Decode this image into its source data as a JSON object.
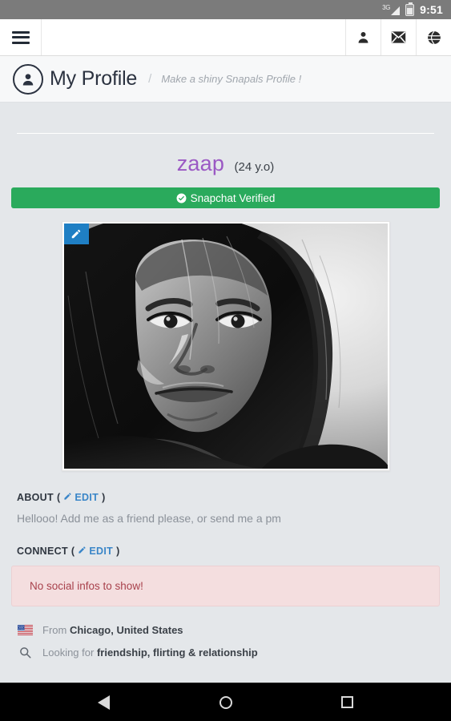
{
  "status_bar": {
    "network_label": "3G",
    "time": "9:51",
    "icons": [
      "signal-icon",
      "battery-icon"
    ]
  },
  "topbar": {
    "menu_icon": "hamburger-menu-icon",
    "actions": [
      {
        "icon": "person-icon",
        "name": "profile"
      },
      {
        "icon": "envelope-icon",
        "name": "messages"
      },
      {
        "icon": "globe-icon",
        "name": "language"
      }
    ]
  },
  "page_header": {
    "icon": "user-circle-icon",
    "title": "My Profile",
    "separator": "/",
    "subtitle": "Make a shiny Snapals Profile !"
  },
  "profile": {
    "username": "zaap",
    "age": "(24 y.o)",
    "verified_badge": {
      "label": "Snapchat Verified",
      "icon": "check-circle-icon",
      "color": "#2aaa5c"
    },
    "photo": {
      "edit_icon": "pencil-icon",
      "alt": "profile-photo"
    }
  },
  "about": {
    "heading": "ABOUT",
    "paren_open": "(",
    "paren_close": ")",
    "edit_label": "EDIT",
    "edit_icon": "pencil-icon",
    "text": "Hellooo! Add me as a friend please, or send me a pm"
  },
  "connect": {
    "heading": "CONNECT",
    "paren_open": "(",
    "paren_close": ")",
    "edit_label": "EDIT",
    "edit_icon": "pencil-icon",
    "alert": "No social infos to show!",
    "alert_bg": "#f4dedf",
    "alert_color": "#a8414c"
  },
  "meta": {
    "location": {
      "icon": "us-flag-icon",
      "prefix": "From ",
      "value": "Chicago, United States"
    },
    "looking_for": {
      "icon": "search-icon",
      "prefix": "Looking for ",
      "value": "friendship, flirting & relationship"
    }
  },
  "navbar": {
    "back": "back-button",
    "home": "home-button",
    "recents": "recents-button"
  },
  "colors": {
    "page_bg": "#e4e7ea",
    "accent_purple": "#9b59c4",
    "accent_blue": "#3a86c8",
    "green": "#2aaa5c"
  }
}
